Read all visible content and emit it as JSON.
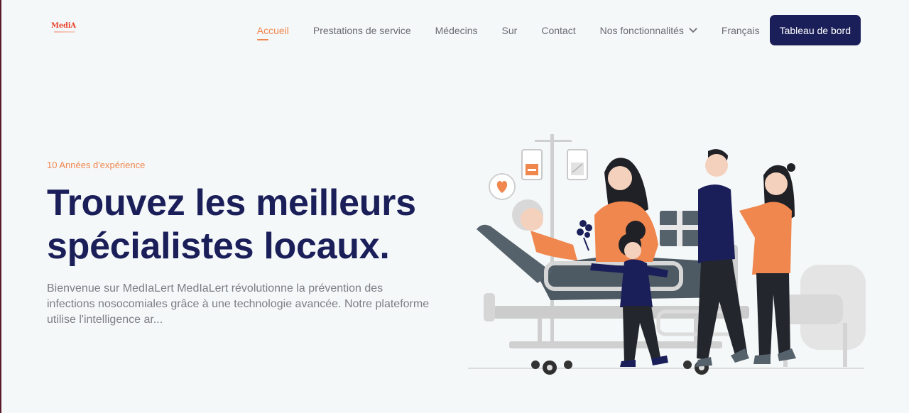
{
  "brand": {
    "logo_text": "MediA",
    "accent": "#f0874f",
    "navy": "#1b1f59",
    "logo_red": "#e8452c"
  },
  "nav": {
    "items": [
      {
        "label": "Accueil",
        "active": true
      },
      {
        "label": "Prestations de service"
      },
      {
        "label": "Médecins"
      },
      {
        "label": "Sur"
      },
      {
        "label": "Contact"
      },
      {
        "label": "Nos fonctionnalités",
        "icon": "chevron-down-icon"
      }
    ],
    "language": "Français",
    "dashboard_button": "Tableau de bord"
  },
  "hero": {
    "eyebrow": "10 Années d'expérience",
    "headline_line1": "Trouvez les meilleurs",
    "headline_line2": "spécialistes locaux.",
    "lead": "Bienvenue sur MedIaLert MedIaLert révolutionne la prévention des infections nosocomiales grâce à une technologie avancée. Notre plateforme utilise l'intelligence ar...",
    "illustration": "hospital-visit-illustration"
  }
}
